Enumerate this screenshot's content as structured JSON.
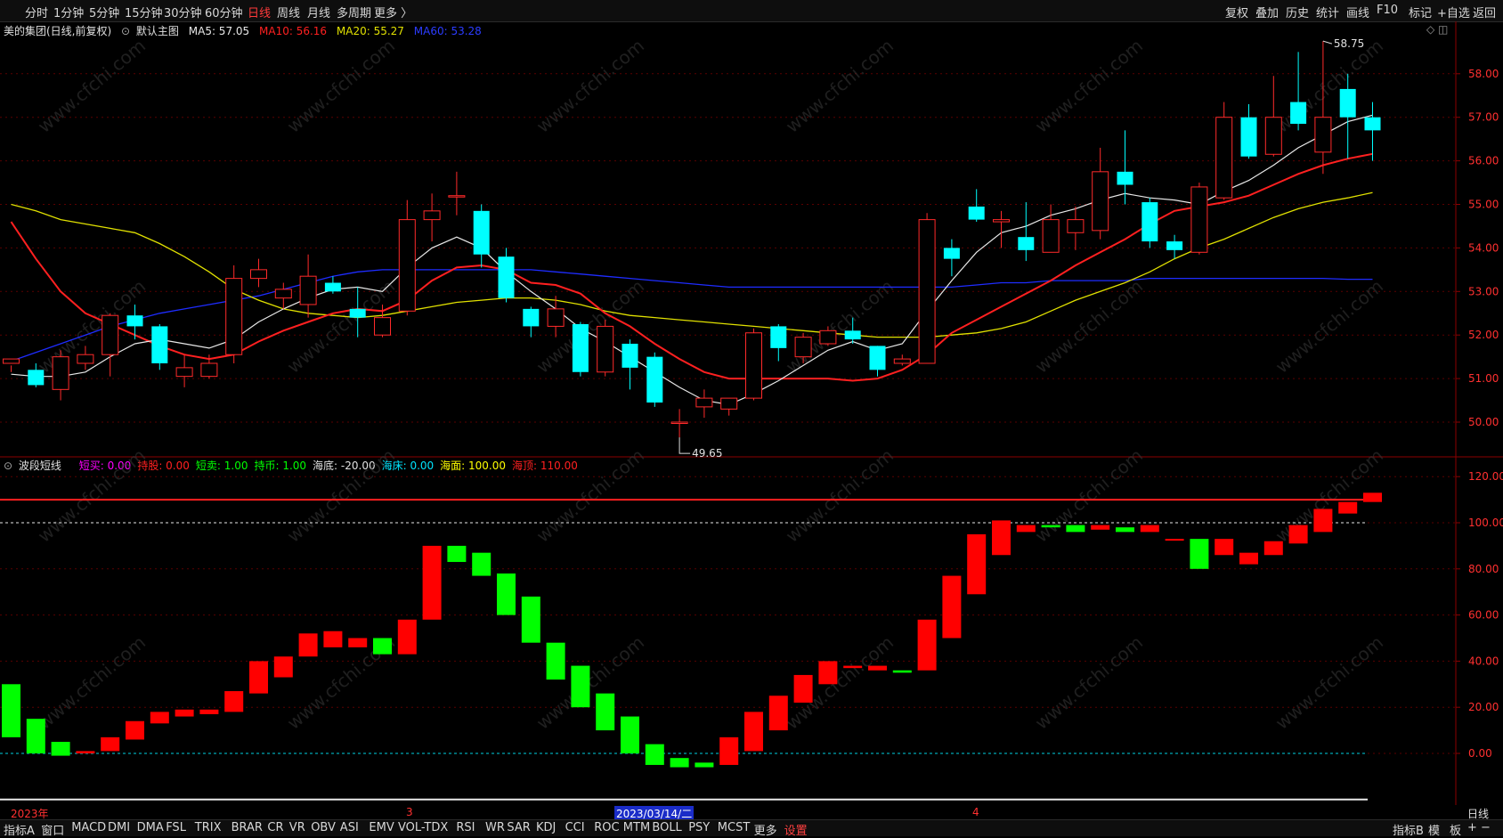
{
  "topbar": {
    "periods": [
      "分时",
      "1分钟",
      "5分钟",
      "15分钟",
      "30分钟",
      "60分钟",
      "日线",
      "周线",
      "月线",
      "多周期",
      "更多 〉"
    ],
    "active_period": "日线",
    "right_tools": [
      "复权",
      "叠加",
      "历史",
      "统计",
      "画线",
      "F10",
      "标记",
      "+自选",
      "返回"
    ]
  },
  "main_legend": {
    "stock": "美的集团(日线,前复权)",
    "template": "默认主图",
    "ma5": "MA5: 57.05",
    "ma10": "MA10: 56.16",
    "ma20": "MA20: 55.27",
    "ma60": "MA60: 53.28",
    "high_label": "58.75",
    "low_label": "49.65"
  },
  "sub_legend": {
    "name": "波段短线",
    "items": [
      {
        "text": "短买: 0.00",
        "color": "#ff00ff"
      },
      {
        "text": "持股: 0.00",
        "color": "#ff2020"
      },
      {
        "text": "短卖: 1.00",
        "color": "#00ff00"
      },
      {
        "text": "持币: 1.00",
        "color": "#00ff00"
      },
      {
        "text": "海底: -20.00",
        "color": "#e0e0e0"
      },
      {
        "text": "海床: 0.00",
        "color": "#00e5ff"
      },
      {
        "text": "海面: 100.00",
        "color": "#ffff00"
      },
      {
        "text": "海顶: 110.00",
        "color": "#ff2020"
      }
    ]
  },
  "dates": {
    "year": "2023年",
    "m3": "3",
    "cursor": "2023/03/14/二",
    "m4": "4",
    "right": "日线"
  },
  "bottombar": {
    "items": [
      "指标A",
      "窗口",
      "MACD",
      "DMI",
      "DMA",
      "FSL",
      "TRIX",
      "BRAR",
      "CR",
      "VR",
      "OBV",
      "ASI",
      "EMV",
      "VOL-TDX",
      "RSI",
      "WR",
      "SAR",
      "KDJ",
      "CCI",
      "ROC",
      "MTM",
      "BOLL",
      "PSY",
      "MCST",
      "更多",
      "设置"
    ],
    "right": [
      "指标B",
      "模",
      "板"
    ]
  },
  "watermark": "www.cfchi.com",
  "colors": {
    "up": "#ff2a2a",
    "down": "#00ffff",
    "ma5": "#e8e8e8",
    "ma10": "#ff2020",
    "ma20": "#e0e000",
    "ma60": "#1e2cff",
    "osc_up": "#ff0000",
    "osc_down": "#00ff00"
  },
  "chart_data": [
    {
      "type": "candlestick",
      "title": "美的集团(日线,前复权)",
      "ylim": [
        49.4,
        59.0
      ],
      "yticks": [
        "50.00",
        "51.00",
        "52.00",
        "53.00",
        "54.00",
        "55.00",
        "56.00",
        "57.00",
        "58.00"
      ],
      "candles": [
        [
          51.35,
          51.45,
          51.3,
          51.15
        ],
        [
          51.2,
          50.85,
          51.35,
          50.8
        ],
        [
          50.75,
          51.5,
          51.65,
          50.5
        ],
        [
          51.35,
          51.55,
          51.75,
          51.2
        ],
        [
          51.55,
          52.45,
          52.5,
          51.05
        ],
        [
          52.45,
          52.2,
          52.7,
          51.9
        ],
        [
          52.2,
          51.35,
          52.25,
          51.2
        ],
        [
          51.05,
          51.25,
          51.55,
          50.8
        ],
        [
          51.05,
          51.35,
          51.55,
          51.0
        ],
        [
          51.55,
          53.3,
          53.6,
          51.35
        ],
        [
          53.3,
          53.5,
          53.75,
          53.1
        ],
        [
          52.85,
          53.05,
          53.2,
          52.6
        ],
        [
          52.7,
          53.35,
          53.85,
          52.4
        ],
        [
          53.2,
          53.0,
          53.35,
          52.95
        ],
        [
          52.6,
          52.4,
          53.1,
          51.95
        ],
        [
          52.0,
          52.4,
          52.7,
          51.95
        ],
        [
          52.55,
          54.65,
          55.1,
          52.45
        ],
        [
          54.65,
          54.85,
          55.25,
          54.15
        ],
        [
          55.2,
          55.2,
          55.75,
          54.75
        ],
        [
          54.85,
          53.85,
          55.0,
          53.55
        ],
        [
          53.8,
          52.85,
          54.0,
          52.75
        ],
        [
          52.6,
          52.2,
          52.65,
          51.95
        ],
        [
          52.2,
          52.6,
          52.9,
          51.95
        ],
        [
          52.25,
          51.15,
          52.3,
          51.05
        ],
        [
          51.15,
          52.2,
          52.35,
          51.05
        ],
        [
          51.8,
          51.25,
          51.9,
          50.75
        ],
        [
          51.5,
          50.45,
          51.6,
          50.35
        ],
        [
          50.0,
          50.0,
          50.3,
          49.65
        ],
        [
          50.35,
          50.55,
          50.75,
          50.1
        ],
        [
          50.3,
          50.55,
          50.5,
          50.15
        ],
        [
          50.55,
          52.05,
          52.15,
          50.5
        ],
        [
          52.2,
          51.7,
          52.25,
          51.4
        ],
        [
          51.5,
          51.95,
          52.05,
          51.35
        ],
        [
          51.8,
          52.1,
          52.2,
          51.75
        ],
        [
          52.1,
          51.9,
          52.4,
          51.8
        ],
        [
          51.75,
          51.2,
          51.75,
          51.05
        ],
        [
          51.35,
          51.45,
          51.55,
          51.3
        ],
        [
          51.35,
          54.65,
          54.8,
          51.35
        ],
        [
          54.0,
          53.75,
          54.2,
          53.35
        ],
        [
          54.95,
          54.65,
          55.35,
          54.6
        ],
        [
          54.6,
          54.65,
          54.85,
          54.0
        ],
        [
          54.25,
          53.95,
          55.05,
          53.7
        ],
        [
          53.9,
          54.65,
          55.0,
          53.9
        ],
        [
          54.35,
          54.65,
          54.95,
          53.95
        ],
        [
          54.4,
          55.75,
          56.3,
          54.2
        ],
        [
          55.75,
          55.45,
          56.7,
          55.0
        ],
        [
          55.05,
          54.15,
          55.15,
          54.0
        ],
        [
          54.15,
          53.95,
          54.3,
          53.75
        ],
        [
          53.9,
          55.4,
          55.5,
          53.85
        ],
        [
          55.15,
          57.0,
          57.35,
          55.1
        ],
        [
          57.0,
          56.1,
          57.3,
          56.05
        ],
        [
          56.15,
          57.0,
          57.95,
          56.1
        ],
        [
          57.35,
          56.85,
          58.5,
          56.7
        ],
        [
          56.2,
          57.0,
          58.75,
          55.7
        ],
        [
          57.65,
          57.0,
          58.0,
          56.05
        ],
        [
          57.0,
          56.7,
          57.35,
          56.0
        ]
      ],
      "ma5": [
        51.1,
        51.05,
        51.05,
        51.15,
        51.5,
        51.8,
        51.9,
        51.8,
        51.7,
        51.9,
        52.3,
        52.6,
        52.85,
        53.05,
        53.1,
        53.0,
        53.55,
        54.0,
        54.25,
        54.0,
        53.45,
        53.0,
        52.6,
        52.15,
        51.85,
        51.5,
        51.15,
        50.8,
        50.5,
        50.4,
        50.65,
        50.95,
        51.3,
        51.65,
        51.85,
        51.65,
        51.8,
        52.55,
        53.25,
        53.9,
        54.35,
        54.5,
        54.75,
        54.9,
        55.1,
        55.25,
        55.15,
        55.1,
        55.0,
        55.3,
        55.55,
        55.9,
        56.3,
        56.6,
        56.9,
        57.05
      ],
      "ma10": [
        54.6,
        53.75,
        53.0,
        52.5,
        52.25,
        52.0,
        51.75,
        51.55,
        51.45,
        51.55,
        51.85,
        52.1,
        52.3,
        52.5,
        52.6,
        52.55,
        52.8,
        53.25,
        53.55,
        53.6,
        53.5,
        53.2,
        53.15,
        52.95,
        52.5,
        52.2,
        51.8,
        51.45,
        51.15,
        51.0,
        51.0,
        51.0,
        51.0,
        51.0,
        50.95,
        51.0,
        51.2,
        51.55,
        52.05,
        52.35,
        52.65,
        52.95,
        53.25,
        53.6,
        53.9,
        54.2,
        54.55,
        54.85,
        54.95,
        55.05,
        55.2,
        55.45,
        55.7,
        55.9,
        56.05,
        56.16
      ],
      "ma20": [
        55.0,
        54.85,
        54.65,
        54.55,
        54.45,
        54.35,
        54.1,
        53.8,
        53.45,
        53.05,
        52.8,
        52.6,
        52.5,
        52.45,
        52.4,
        52.45,
        52.55,
        52.65,
        52.75,
        52.8,
        52.85,
        52.85,
        52.8,
        52.7,
        52.55,
        52.45,
        52.4,
        52.35,
        52.3,
        52.25,
        52.2,
        52.15,
        52.1,
        52.05,
        52.0,
        51.95,
        51.95,
        51.95,
        52.0,
        52.05,
        52.15,
        52.3,
        52.55,
        52.8,
        53.0,
        53.2,
        53.45,
        53.75,
        54.0,
        54.2,
        54.45,
        54.7,
        54.9,
        55.05,
        55.15,
        55.27
      ],
      "ma60": [
        51.4,
        51.6,
        51.8,
        52.0,
        52.2,
        52.35,
        52.5,
        52.6,
        52.7,
        52.8,
        52.9,
        53.05,
        53.2,
        53.35,
        53.45,
        53.5,
        53.5,
        53.5,
        53.5,
        53.5,
        53.5,
        53.5,
        53.45,
        53.4,
        53.35,
        53.3,
        53.25,
        53.2,
        53.15,
        53.1,
        53.1,
        53.1,
        53.1,
        53.1,
        53.1,
        53.1,
        53.1,
        53.1,
        53.1,
        53.15,
        53.2,
        53.2,
        53.25,
        53.25,
        53.25,
        53.25,
        53.3,
        53.3,
        53.3,
        53.3,
        53.3,
        53.3,
        53.3,
        53.3,
        53.28,
        53.28
      ]
    },
    {
      "type": "bar",
      "title": "波段短线",
      "ylim": [
        -20,
        126
      ],
      "yticks": [
        "0.00",
        "20.00",
        "40.00",
        "60.00",
        "80.00",
        "100.00",
        "120.00"
      ],
      "lines": {
        "海床": 0,
        "海面": 100,
        "海顶": 110
      },
      "bars": [
        [
          30,
          7
        ],
        [
          15,
          0
        ],
        [
          5,
          -1
        ],
        [
          0,
          1
        ],
        [
          1,
          7
        ],
        [
          6,
          14
        ],
        [
          13,
          18
        ],
        [
          16,
          19
        ],
        [
          17,
          19
        ],
        [
          18,
          27
        ],
        [
          26,
          40
        ],
        [
          33,
          42
        ],
        [
          42,
          52
        ],
        [
          46,
          53
        ],
        [
          46,
          50
        ],
        [
          50,
          43
        ],
        [
          43,
          58
        ],
        [
          58,
          90
        ],
        [
          90,
          83
        ],
        [
          87,
          77
        ],
        [
          78,
          60
        ],
        [
          68,
          48
        ],
        [
          48,
          32
        ],
        [
          38,
          20
        ],
        [
          26,
          10
        ],
        [
          16,
          0
        ],
        [
          4,
          -5
        ],
        [
          -2,
          -6
        ],
        [
          -4,
          -6
        ],
        [
          -5,
          7
        ],
        [
          1,
          18
        ],
        [
          10,
          25
        ],
        [
          22,
          34
        ],
        [
          30,
          40
        ],
        [
          37,
          38
        ],
        [
          36,
          38
        ],
        [
          36,
          35
        ],
        [
          36,
          58
        ],
        [
          50,
          77
        ],
        [
          69,
          95
        ],
        [
          86,
          101
        ],
        [
          96,
          99
        ],
        [
          99,
          98
        ],
        [
          99,
          96
        ],
        [
          97,
          99
        ],
        [
          98,
          96
        ],
        [
          96,
          99
        ],
        [
          93,
          93
        ],
        [
          93,
          80
        ],
        [
          86,
          93
        ],
        [
          82,
          87
        ],
        [
          86,
          92
        ],
        [
          91,
          99
        ],
        [
          96,
          106
        ],
        [
          104,
          109
        ],
        [
          109,
          113
        ]
      ]
    }
  ]
}
